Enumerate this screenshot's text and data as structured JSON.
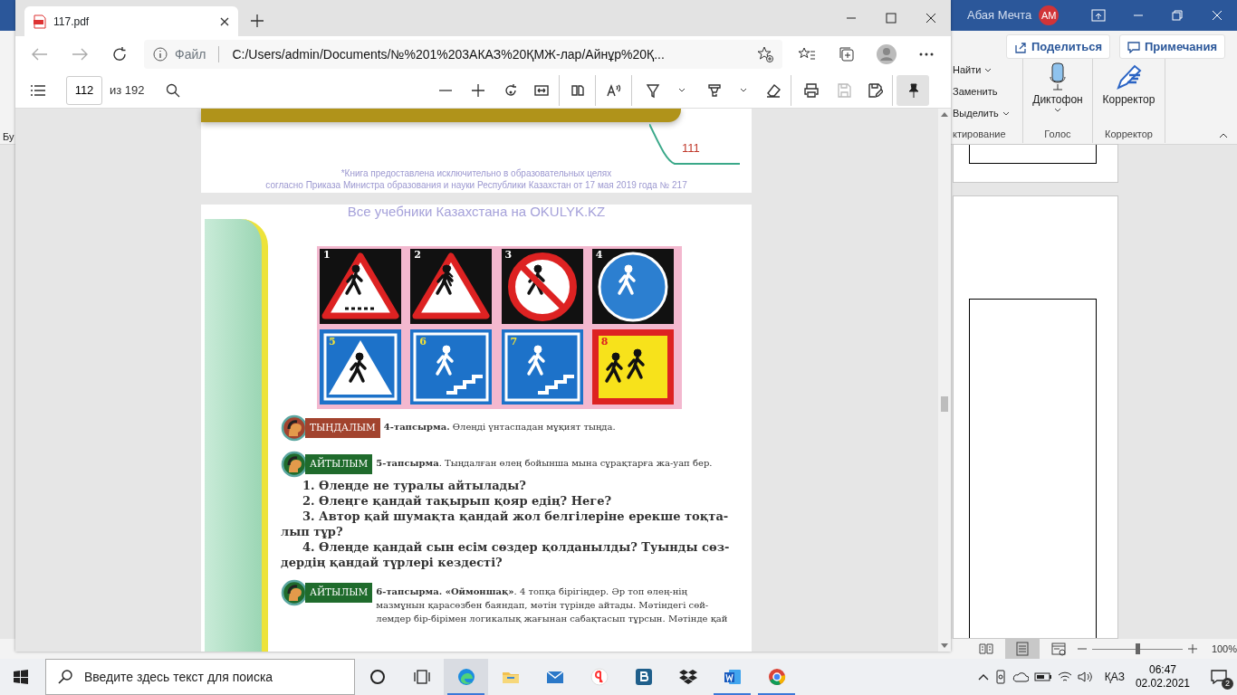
{
  "word": {
    "left_fragment": "Бу",
    "user": "Абая Мечта",
    "avatar": "АМ",
    "share": "Поделиться",
    "comments": "Примечания",
    "ribbon_groups": [
      {
        "kind": "list",
        "label": "ктирование",
        "items": [
          {
            "label": "Найти",
            "dropdown": true
          },
          {
            "label": "Заменить",
            "dropdown": false
          },
          {
            "label": "Выделить",
            "dropdown": true
          }
        ]
      },
      {
        "kind": "mic",
        "label": "Голос",
        "button": "Диктофон",
        "dropdown": true
      },
      {
        "kind": "pen",
        "label": "Корректор",
        "button": "Корректор",
        "dropdown": false
      }
    ],
    "views": [
      {
        "kind": "read",
        "selected": false
      },
      {
        "kind": "print",
        "selected": true
      },
      {
        "kind": "web",
        "selected": false
      }
    ],
    "zoom": {
      "level": 0.5,
      "reading": "100%"
    }
  },
  "edge": {
    "tab": {
      "title": "117.pdf"
    },
    "address": {
      "label": "Файл",
      "url": "C:/Users/admin/Documents/№%201%203АКАЗ%20ҚМЖ-лар/Айнұр%20Қ..."
    },
    "page_box": {
      "value": "112",
      "total": "из 192"
    },
    "tools": [
      {
        "kind": "zoom-out",
        "disabled": false,
        "selected": false,
        "caret": false,
        "sep": false
      },
      {
        "kind": "zoom-in",
        "disabled": false,
        "selected": false,
        "caret": false,
        "sep": false
      },
      {
        "kind": "rotate",
        "disabled": false,
        "selected": false,
        "caret": false,
        "sep": false
      },
      {
        "kind": "fit",
        "disabled": false,
        "selected": false,
        "caret": false,
        "sep": true
      },
      {
        "kind": "page-view",
        "disabled": false,
        "selected": false,
        "caret": false,
        "sep": true
      },
      {
        "kind": "read-aloud",
        "disabled": false,
        "selected": false,
        "caret": false,
        "sep": true
      },
      {
        "kind": "draw",
        "disabled": false,
        "selected": false,
        "caret": true,
        "sep": false
      },
      {
        "kind": "highlight",
        "disabled": false,
        "selected": false,
        "caret": true,
        "sep": false
      },
      {
        "kind": "erase",
        "disabled": false,
        "selected": false,
        "caret": false,
        "sep": true
      },
      {
        "kind": "print",
        "disabled": false,
        "selected": false,
        "caret": false,
        "sep": false
      },
      {
        "kind": "save",
        "disabled": true,
        "selected": false,
        "caret": false,
        "sep": false
      },
      {
        "kind": "save-as",
        "disabled": false,
        "selected": false,
        "caret": false,
        "sep": true
      },
      {
        "kind": "pin",
        "disabled": false,
        "selected": true,
        "caret": false,
        "sep": false
      }
    ],
    "page_prev": {
      "number": "111",
      "footer": [
        "*Книга предоставлена исключительно в образовательных целях",
        "согласно Приказа Министра образования и науки Республики Казахстан от 17 мая 2019 года № 217"
      ]
    },
    "page": {
      "header": "Все учебники Казахстана на OKULYK.KZ",
      "signs": [
        {
          "number": "1",
          "kind": "crossing-warning"
        },
        {
          "number": "2",
          "kind": "children-warning"
        },
        {
          "number": "3",
          "kind": "no-pedestrians"
        },
        {
          "number": "4",
          "kind": "footpath"
        },
        {
          "number": "5",
          "kind": "crosswalk"
        },
        {
          "number": "6",
          "kind": "stairs-down"
        },
        {
          "number": "7",
          "kind": "stairs-up"
        },
        {
          "number": "8",
          "kind": "children"
        }
      ],
      "tasks": [
        {
          "badge": "ТЫҢДАЛЫМ",
          "color": "#a2432e",
          "text": "**4-тапсырма.**  Өлеңді үнтаспадан мұқият тыңда."
        },
        {
          "badge": "АЙТЫЛЫМ",
          "color": "#1f6b2c",
          "text": "**5-тапсырма**. Тыңдалған өлең бойынша мына сұрақтарға жа-уап бер.",
          "questions": [
            "1. Өлеңде не туралы айтылады?",
            "2. Өлеңге қандай тақырып қояр едің? Неге?",
            "3. Автор қай шумақта қандай жол белгілеріне ерекше тоқта-лып тұр?",
            "4. Өлеңде қандай сын есім сөздер қолданылды? Туынды сөз-дердің қандай түрлері кездесті?"
          ]
        },
        {
          "badge": "АЙТЫЛЫМ",
          "color": "#1f6b2c",
          "text": "**6-тапсырма. «Оймоншақ»**. 4 топқа бірігіңдер. Әр топ өлең-нің мазмұнын қарасөзбен баяндап, мәтін түрінде айтады. Мәтіндегі сөй-лемдер бір-бірімен логикалық жағынан сабақтасып тұрсын. Мәтінде қай"
        }
      ]
    }
  },
  "taskbar": {
    "search": {
      "placeholder": "Введите здесь текст для поиска"
    },
    "apps": [
      {
        "kind": "cortana",
        "selected": false,
        "running": false
      },
      {
        "kind": "task-view",
        "selected": false,
        "running": false
      },
      {
        "kind": "edge",
        "selected": true,
        "running": true
      },
      {
        "kind": "folder",
        "selected": false,
        "running": false
      },
      {
        "kind": "mail",
        "selected": false,
        "running": false
      },
      {
        "kind": "yandex",
        "selected": false,
        "running": false
      },
      {
        "kind": "b-app",
        "selected": false,
        "running": false
      },
      {
        "kind": "dropbox",
        "selected": false,
        "running": false
      },
      {
        "kind": "word",
        "selected": false,
        "running": true
      },
      {
        "kind": "chrome",
        "selected": false,
        "running": true
      }
    ],
    "language": "ҚАЗ",
    "time": "06:47",
    "date": "02.02.2021",
    "notifications": "2"
  }
}
